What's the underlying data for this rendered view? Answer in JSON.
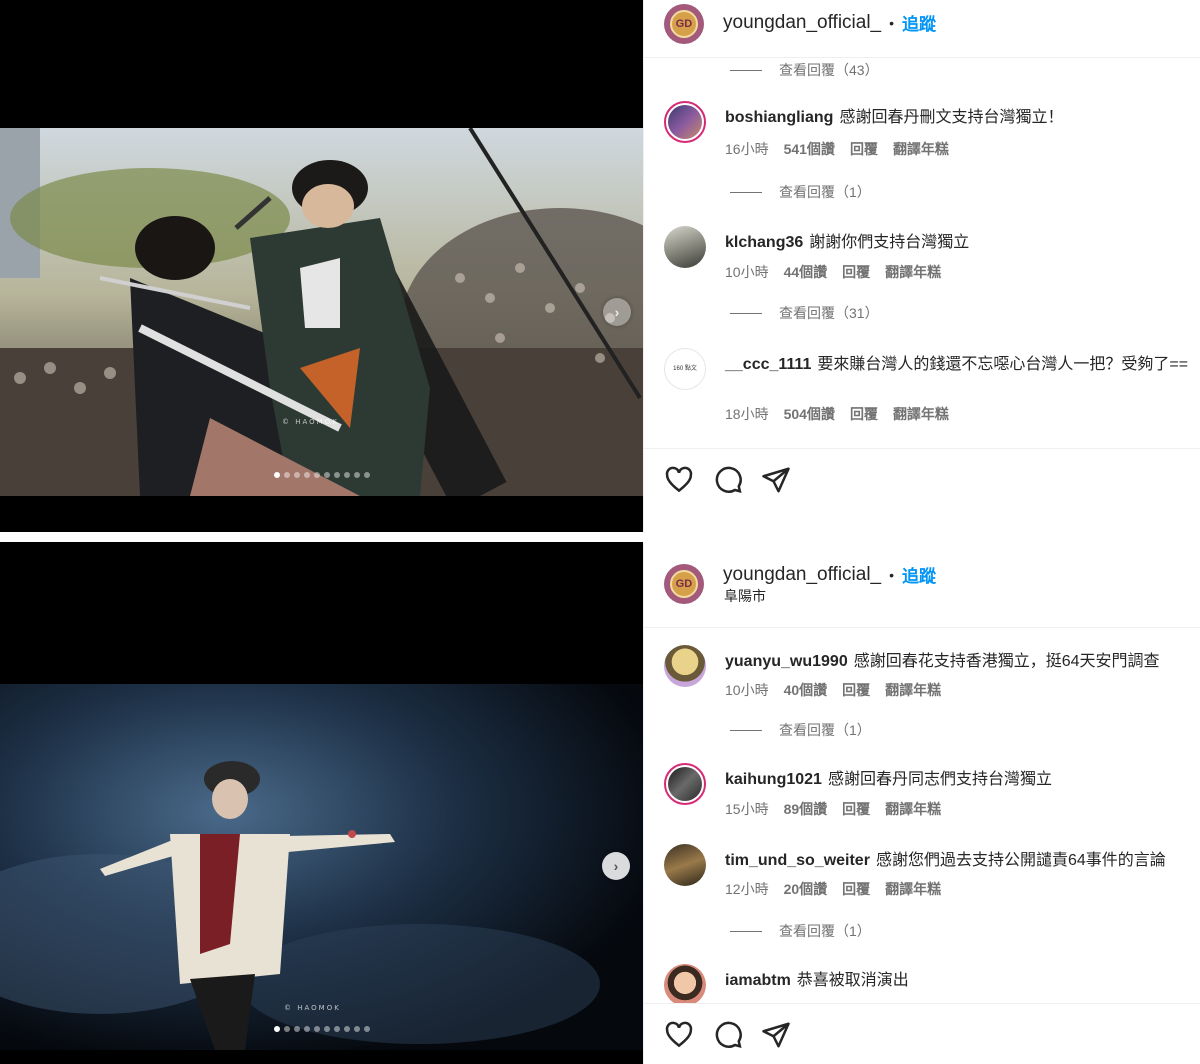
{
  "posts": [
    {
      "username": "youngdan_official_",
      "separator": "•",
      "follow_label": "追蹤",
      "location": "",
      "avatar_text": "GD",
      "dots_count": 10,
      "active_dot": 0,
      "watermark": "© HAOMOK",
      "top_replies": "查看回覆（43）",
      "comments": [
        {
          "user": "boshiangliang",
          "text": "感謝回春丹刪文支持台灣獨立！",
          "time": "16小時",
          "likes": "541個讚",
          "reply": "回覆",
          "translate": "翻譯年糕",
          "replies": "查看回覆（1）"
        },
        {
          "user": "klchang36",
          "text": "謝謝你們支持台灣獨立",
          "time": "10小時",
          "likes": "44個讚",
          "reply": "回覆",
          "translate": "翻譯年糕",
          "replies": "查看回覆（31）"
        },
        {
          "user": "__ccc_1111",
          "text": "要來賺台灣人的錢還不忘噁心台灣人一把？受夠了==",
          "time": "18小時",
          "likes": "504個讚",
          "reply": "回覆",
          "translate": "翻譯年糕",
          "replies": "",
          "avatar_text": "160 點文"
        }
      ]
    },
    {
      "username": "youngdan_official_",
      "separator": "•",
      "follow_label": "追蹤",
      "location": "阜陽市",
      "avatar_text": "GD",
      "dots_count": 10,
      "active_dot": 0,
      "watermark": "© HAOMOK",
      "comments": [
        {
          "user": "yuanyu_wu1990",
          "text": "感謝回春花支持香港獨立，挺64天安門調查",
          "time": "10小時",
          "likes": "40個讚",
          "reply": "回覆",
          "translate": "翻譯年糕",
          "replies": "查看回覆（1）"
        },
        {
          "user": "kaihung1021",
          "text": "感謝回春丹同志們支持台灣獨立",
          "time": "15小時",
          "likes": "89個讚",
          "reply": "回覆",
          "translate": "翻譯年糕",
          "replies": ""
        },
        {
          "user": "tim_und_so_weiter",
          "text": "感謝您們過去支持公開譴責64事件的言論",
          "time": "12小時",
          "likes": "20個讚",
          "reply": "回覆",
          "translate": "翻譯年糕",
          "replies": "查看回覆（1）"
        },
        {
          "user": "iamabtm",
          "text": "恭喜被取消演出",
          "time": "",
          "likes": "",
          "reply": "",
          "translate": "",
          "replies": ""
        }
      ]
    }
  ],
  "icons": {
    "like": "heart-icon",
    "comment": "comment-bubble-icon",
    "share": "paper-plane-icon",
    "next": "chevron-right-icon"
  },
  "colors": {
    "follow": "#0095f6",
    "meta": "#737373",
    "text": "#262626",
    "ring": "#d62976"
  }
}
